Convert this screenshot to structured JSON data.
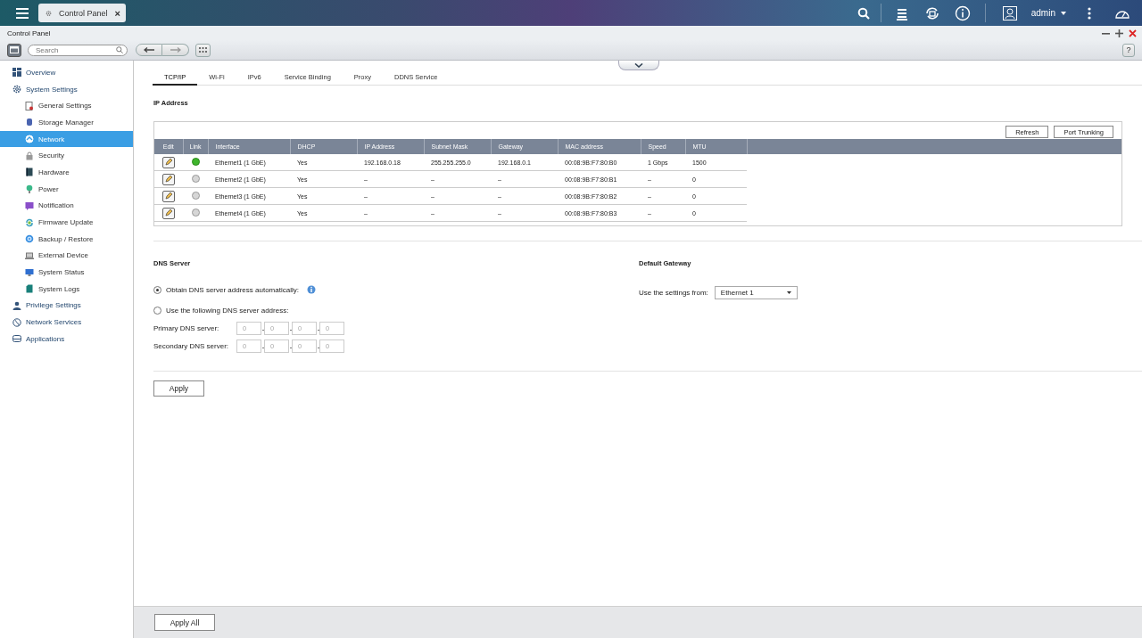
{
  "top_bar": {
    "app_tab": {
      "label": "Control Panel",
      "close": "×",
      "selected": true
    },
    "user": "admin"
  },
  "window": {
    "title": "Control Panel",
    "search": {
      "placeholder": "Search"
    },
    "help": "?"
  },
  "sidebar": {
    "items": [
      {
        "label": "Overview",
        "selected": false
      },
      {
        "label": "System Settings",
        "selected": false,
        "children": [
          {
            "label": "General Settings",
            "selected": false
          },
          {
            "label": "Storage Manager",
            "selected": false
          },
          {
            "label": "Network",
            "selected": true
          },
          {
            "label": "Security",
            "selected": false
          },
          {
            "label": "Hardware",
            "selected": false
          },
          {
            "label": "Power",
            "selected": false
          },
          {
            "label": "Notification",
            "selected": false
          },
          {
            "label": "Firmware Update",
            "selected": false
          },
          {
            "label": "Backup / Restore",
            "selected": false
          },
          {
            "label": "External Device",
            "selected": false
          },
          {
            "label": "System Status",
            "selected": false
          },
          {
            "label": "System Logs",
            "selected": false
          }
        ]
      },
      {
        "label": "Privilege Settings",
        "selected": false
      },
      {
        "label": "Network Services",
        "selected": false
      },
      {
        "label": "Applications",
        "selected": false
      }
    ]
  },
  "tabs": [
    {
      "label": "TCP/IP",
      "selected": true
    },
    {
      "label": "Wi-Fi",
      "selected": false
    },
    {
      "label": "IPv6",
      "selected": false
    },
    {
      "label": "Service Binding",
      "selected": false
    },
    {
      "label": "Proxy",
      "selected": false
    },
    {
      "label": "DDNS Service",
      "selected": false
    }
  ],
  "ip_address": {
    "title": "IP Address",
    "buttons": [
      "Refresh",
      "Port Trunking"
    ],
    "table": {
      "columns": [
        "Edit",
        "Link",
        "Interface",
        "DHCP",
        "IP Address",
        "Subnet Mask",
        "Gateway",
        "MAC address",
        "Speed",
        "MTU"
      ],
      "rows": [
        {
          "link": true,
          "cells": [
            "",
            "",
            "Ethernet1 (1 GbE)",
            "Yes",
            "192.168.0.18",
            "255.255.255.0",
            "192.168.0.1",
            "00:08:9B:F7:80:B0",
            "1 Gbps",
            "1500"
          ]
        },
        {
          "link": false,
          "cells": [
            "",
            "",
            "Ethernet2 (1 GbE)",
            "Yes",
            "–",
            "–",
            "–",
            "00:08:9B:F7:80:B1",
            "–",
            "0"
          ]
        },
        {
          "link": false,
          "cells": [
            "",
            "",
            "Ethernet3 (1 GbE)",
            "Yes",
            "–",
            "–",
            "–",
            "00:08:9B:F7:80:B2",
            "–",
            "0"
          ]
        },
        {
          "link": false,
          "cells": [
            "",
            "",
            "Ethernet4 (1 GbE)",
            "Yes",
            "–",
            "–",
            "–",
            "00:08:9B:F7:80:B3",
            "–",
            "0"
          ]
        }
      ]
    }
  },
  "dns": {
    "title": "DNS Server",
    "options": [
      {
        "label": "Obtain DNS server address automatically:",
        "selected": true
      },
      {
        "label": "Use the following DNS server address:",
        "selected": false
      }
    ],
    "servers": [
      {
        "label": "Primary DNS server:",
        "disabled": true,
        "octets": [
          "0",
          "0",
          "0",
          "0"
        ]
      },
      {
        "label": "Secondary DNS server:",
        "disabled": true,
        "octets": [
          "0",
          "0",
          "0",
          "0"
        ]
      }
    ]
  },
  "gateway": {
    "title": "Default Gateway",
    "label": "Use the settings from:",
    "value": "Ethernet 1"
  },
  "apply": "Apply",
  "apply_all": "Apply All"
}
